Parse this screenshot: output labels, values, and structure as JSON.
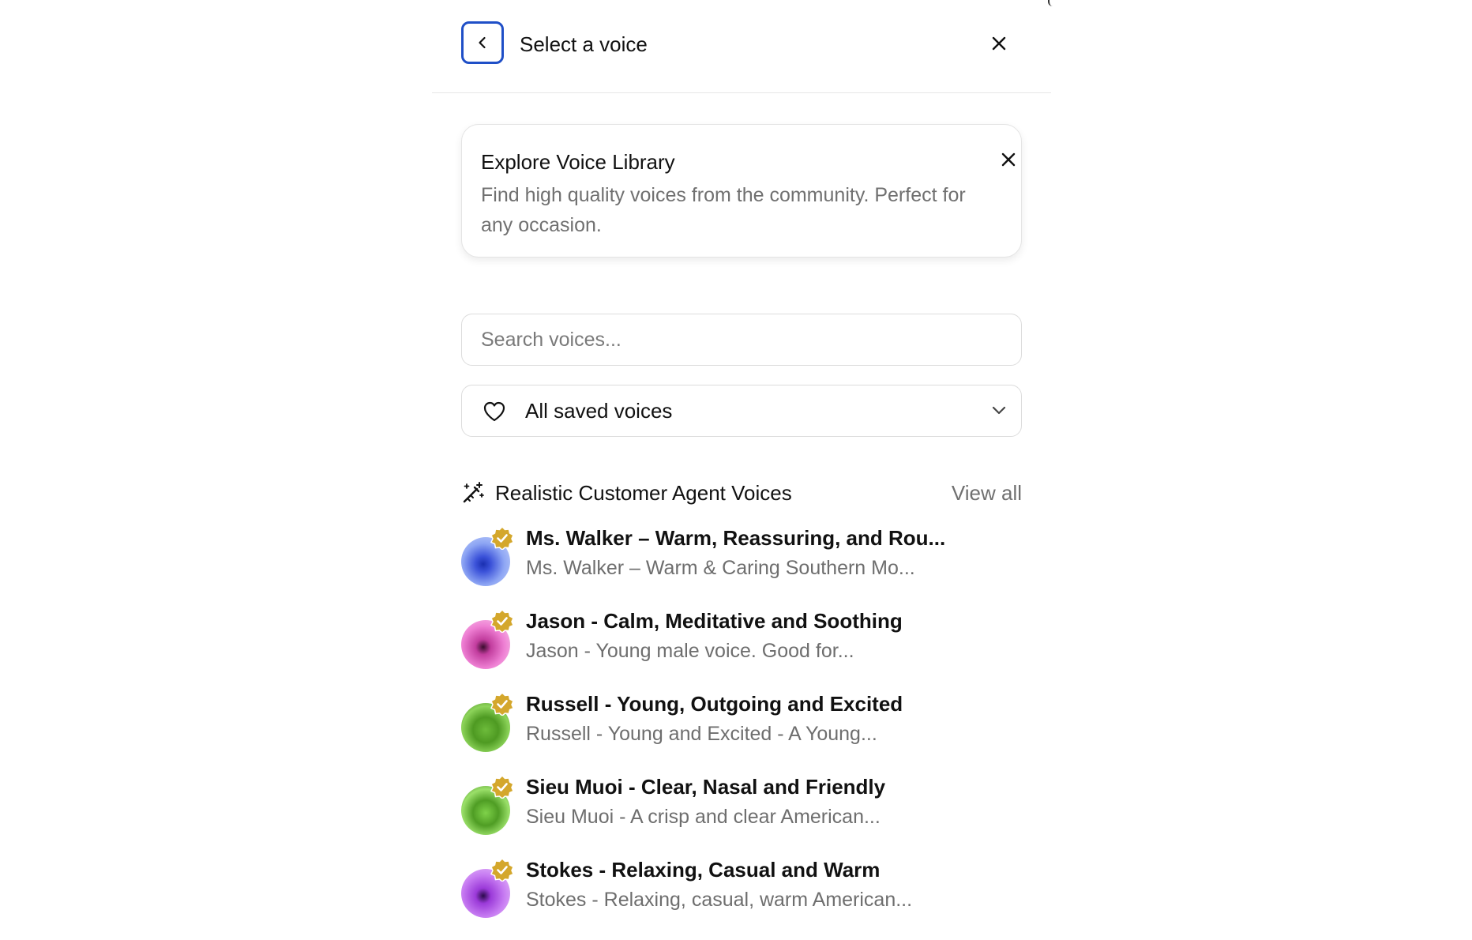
{
  "header": {
    "title": "Select a voice"
  },
  "promo": {
    "title": "Explore Voice Library",
    "description": "Find high quality voices from the community. Perfect for any occasion."
  },
  "search": {
    "placeholder": "Search voices..."
  },
  "filter": {
    "selected": "All saved voices"
  },
  "section": {
    "title": "Realistic Customer Agent Voices",
    "view_all": "View all"
  },
  "voices": [
    {
      "name": "Ms. Walker – Warm, Reassuring, and Rou...",
      "description": "Ms. Walker – Warm & Caring Southern Mo..."
    },
    {
      "name": "Jason - Calm, Meditative and Soothing",
      "description": "Jason - Young male voice. Good for..."
    },
    {
      "name": "Russell - Young, Outgoing and Excited",
      "description": "Russell - Young and Excited - A Young..."
    },
    {
      "name": "Sieu Muoi - Clear, Nasal and Friendly",
      "description": "Sieu Muoi - A crisp and clear American..."
    },
    {
      "name": "Stokes - Relaxing, Casual and Warm",
      "description": "Stokes - Relaxing, casual, warm American..."
    }
  ],
  "colors": {
    "focus_ring": "#1f4fc7",
    "badge_gold": "#d4a72c",
    "muted_text": "#707070",
    "border": "#dcdcdc"
  },
  "icons": {
    "back": "chevron-left-icon",
    "close": "close-icon",
    "favorite": "heart-icon",
    "dropdown": "chevron-down-icon",
    "section": "magic-wand-icon",
    "verified": "verified-badge-icon"
  }
}
